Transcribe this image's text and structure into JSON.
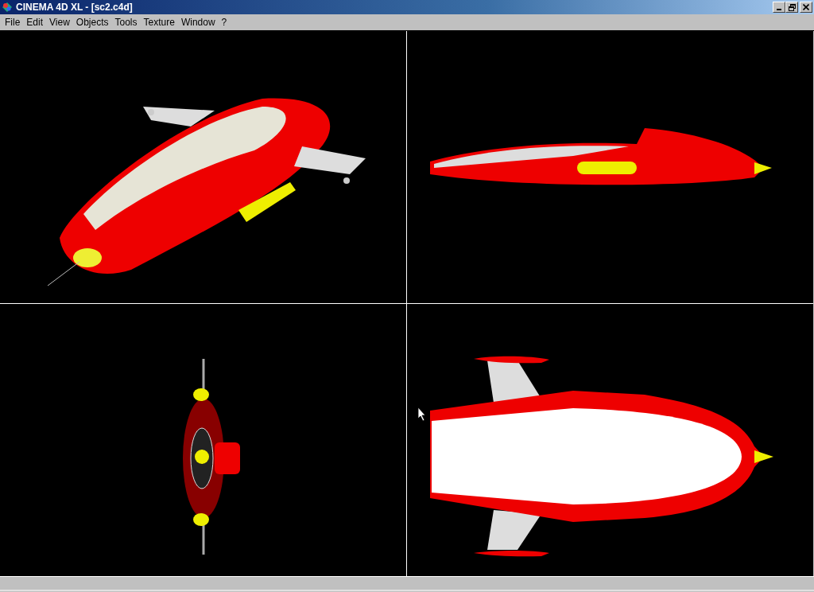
{
  "window": {
    "title": "CINEMA 4D XL - [sc2.c4d]"
  },
  "menu": [
    "File",
    "Edit",
    "View",
    "Objects",
    "Tools",
    "Texture",
    "Window",
    "?"
  ],
  "viewports": [
    {
      "kind": "perspective"
    },
    {
      "kind": "side"
    },
    {
      "kind": "front"
    },
    {
      "kind": "top"
    }
  ]
}
